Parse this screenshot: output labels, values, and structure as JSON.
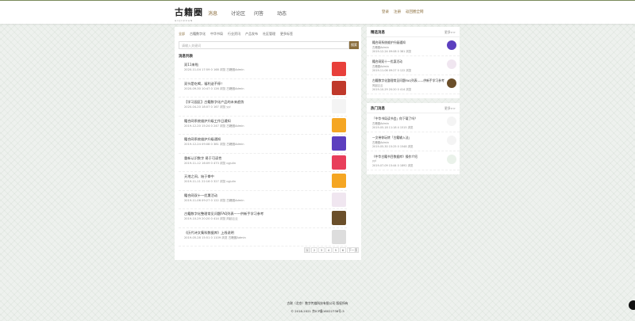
{
  "header": {
    "logo": "古籍圈",
    "logo_sub": "GUJIQUAN",
    "nav": [
      {
        "label": "消息",
        "active": true
      },
      {
        "label": "讨论区",
        "active": false
      },
      {
        "label": "问答",
        "active": false
      },
      {
        "label": "动态",
        "active": false
      }
    ],
    "user_links": [
      "登录",
      "注册",
      "返回圈全网"
    ]
  },
  "main": {
    "categories": [
      "全部",
      "古籍数字化",
      "中华书局",
      "行业资讯",
      "产品发布",
      "社区管理",
      "更多标签"
    ],
    "search": {
      "placeholder": "请输入关键词",
      "button": "搜索"
    },
    "list_title": "消息列表",
    "items": [
      {
        "title": "双11来啦",
        "meta": "2020-11-04 17:59   0   168 浏览   古籍圈Admin",
        "thumb_color": "#e8403b"
      },
      {
        "title": "双节是吃喝，福利送不停！",
        "meta": "2020-09-30 10:47   0   126 浏览   古籍圈Admin",
        "thumb_color": "#c0392b"
      },
      {
        "title": "【学习园区】古籍数字化产品的未来趋势",
        "meta": "2020-04-20 18:07   0   167 浏览   yyl",
        "thumb_color": "#f4f4f4"
      },
      {
        "title": "籍合网系统维护升级工作日通知",
        "meta": "2019-12-20 15:24   0   247 浏览   古籍圈Admin",
        "thumb_color": "#f5a623"
      },
      {
        "title": "籍合网系统维护升级通知",
        "meta": "2019-12-24 09:08   0   381 浏览   古籍圈Admin",
        "thumb_color": "#5c3fbf"
      },
      {
        "title": "重新认识数字 易于可读性",
        "meta": "2019-11-12 16:09   0   473 浏览   cgjulin",
        "thumb_color": "#e83e5a"
      },
      {
        "title": "天地之间，始于拳中",
        "meta": "2019-11-11 22:16   0   327 浏览   cgjulin",
        "thumb_color": "#f5a623"
      },
      {
        "title": "籍合网双十一优惠活动",
        "meta": "2019-11-06 09:27   0   122 浏览   古籍圈Admin",
        "thumb_color": "#f0e6f0"
      },
      {
        "title": "古籍数字化整理常见问题FAQ列表——供新手学习参考",
        "meta": "2019-10-29 20:20   0   414 浏览   风起云云",
        "thumb_color": "#6b4f2a"
      },
      {
        "title": "《历代诗文集科数据库》上线说明",
        "meta": "2019-05-28 15:51   0   1109 浏览   古籍圈Admin",
        "thumb_color": "#ddd"
      }
    ],
    "pagination": [
      "1",
      "2",
      "3",
      "4",
      "5",
      "6",
      "下一页"
    ]
  },
  "sidebar": {
    "featured": {
      "title": "精选消息",
      "more": "更多>>",
      "items": [
        {
          "title": "籍合网系统维护升级通知",
          "author": "古籍圈Admin",
          "meta": "2019-12-24 09:08   0   381 浏览",
          "thumb_color": "#5c3fbf"
        },
        {
          "title": "籍合网双十一优惠活动",
          "author": "古籍圈Admin",
          "meta": "2019-11-06 09:27   0   122 浏览",
          "thumb_color": "#f0e6f0"
        },
        {
          "title": "古籍数字化整理常见问题FAQ列表——供新手学习参考",
          "author": "风起云云",
          "meta": "2019-10-29 20:20   0   414 浏览",
          "thumb_color": "#6b4f2a"
        }
      ]
    },
    "hot": {
      "title": "热门消息",
      "more": "更多>>",
      "items": [
        {
          "title": "「中华书局读书会」你下载了吗？",
          "author": "古籍圈Admin",
          "meta": "2019-05-18 11:18   4   1515 浏览",
          "thumb_color": "#f4f4f4"
        },
        {
          "title": "一文带你玩转「古籍输入法」",
          "author": "古籍圈Admin",
          "meta": "2019-05-30 15:25   0   1548 浏览",
          "thumb_color": "#f4f4f4"
        },
        {
          "title": "《中华古籍书目数据库》操作介绍",
          "author": "yyl",
          "meta": "2019-07-09 15:44   0   1892 浏览",
          "thumb_color": "#eaf2ea"
        }
      ]
    }
  },
  "footer": {
    "line1": "古联（北京）数字传媒科技有限公司 版权所有",
    "line2": "© 2018-2021 京ICP备16022738号-5"
  }
}
